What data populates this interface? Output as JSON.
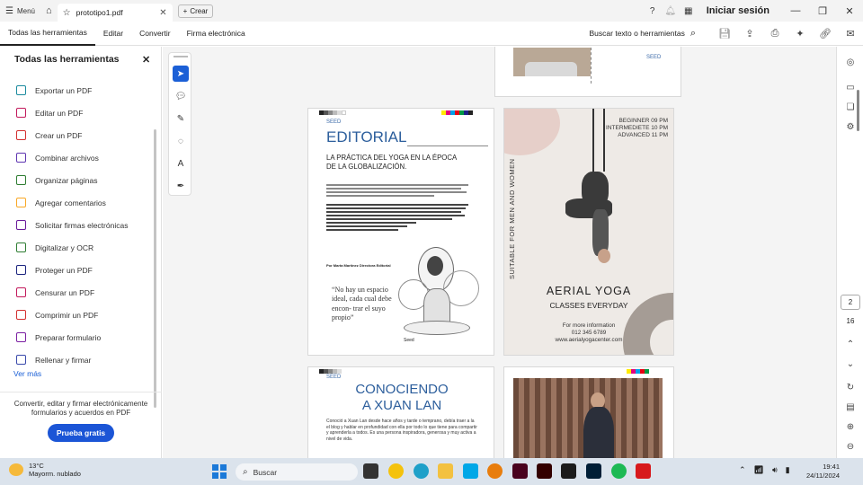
{
  "titlebar": {
    "menu_label": "Menú",
    "tab_title": "prototipo1.pdf",
    "new_tab_label": "Crear",
    "signin_label": "Iniciar sesión"
  },
  "menubar": {
    "tabs": [
      "Todas las herramientas",
      "Editar",
      "Convertir",
      "Firma electrónica"
    ],
    "search_label": "Buscar texto o herramientas"
  },
  "left_panel": {
    "title": "Todas las herramientas",
    "tools": [
      {
        "label": "Exportar un PDF",
        "color": "#1a8a9e"
      },
      {
        "label": "Editar un PDF",
        "color": "#c2185b"
      },
      {
        "label": "Crear un PDF",
        "color": "#d32f2f"
      },
      {
        "label": "Combinar archivos",
        "color": "#5e35b1"
      },
      {
        "label": "Organizar páginas",
        "color": "#2e7d32"
      },
      {
        "label": "Agregar comentarios",
        "color": "#f9a825"
      },
      {
        "label": "Solicitar firmas electrónicas",
        "color": "#6a1b9a"
      },
      {
        "label": "Digitalizar y OCR",
        "color": "#2e7d32"
      },
      {
        "label": "Proteger un PDF",
        "color": "#1a237e"
      },
      {
        "label": "Censurar un PDF",
        "color": "#c2185b"
      },
      {
        "label": "Comprimir un PDF",
        "color": "#d32f2f"
      },
      {
        "label": "Preparar formulario",
        "color": "#7b1fa2"
      },
      {
        "label": "Rellenar y firmar",
        "color": "#3949ab"
      }
    ],
    "see_more": "Ver más",
    "promo_text": "Convertir, editar y firmar electrónicamente formularios y acuerdos en PDF",
    "trial_button": "Prueba gratis"
  },
  "document": {
    "editorial": {
      "seed": "SEED",
      "title": "EDITORIAL",
      "subtitle": "LA PRÁCTICA DEL YOGA EN LA ÉPOCA DE LA GLOBALIZACIÓN.",
      "quote": "“No hay un espacio ideal, cada cual debe encon- trar el suyo propio”",
      "author": "Por Marta Martínez Directora Editorial",
      "sign": "Seed"
    },
    "yoga": {
      "times": [
        "BEGINNER 09 PM",
        "INTERMEDIETE 10 PM",
        "ADVANCED 11 PM"
      ],
      "side_text": "SUITABLE FOR MEN AND WOMEN",
      "title": "AERIAL YOGA",
      "subtitle": "CLASSES EVERYDAY",
      "info": [
        "For more information",
        "012 345 6789",
        "www.aerialyogacenter.com"
      ]
    },
    "xuan": {
      "seed": "SEED",
      "title_line1": "CONOCIENDO",
      "title_line2": "A XUAN LAN",
      "body": "Conoció a Xuan Lan desde hace años y tarde o temprano, debía traer a la el blog y hablar en profundidad con ella por todo lo que tiene para compartir y aprenderla a todos. Es una persona inspiradora, generosa y muy activa a nivel de vida."
    },
    "top_seed": "SEED"
  },
  "right_rail": {
    "current_page": "2",
    "total_pages": "16"
  },
  "taskbar": {
    "temperature": "13°C",
    "weather": "Mayorm. nublado",
    "search_label": "Buscar",
    "time": "19:41",
    "date": "24/11/2024"
  },
  "colors": {
    "accent": "#1b55d6",
    "editorial_blue": "#2c5e9c"
  }
}
